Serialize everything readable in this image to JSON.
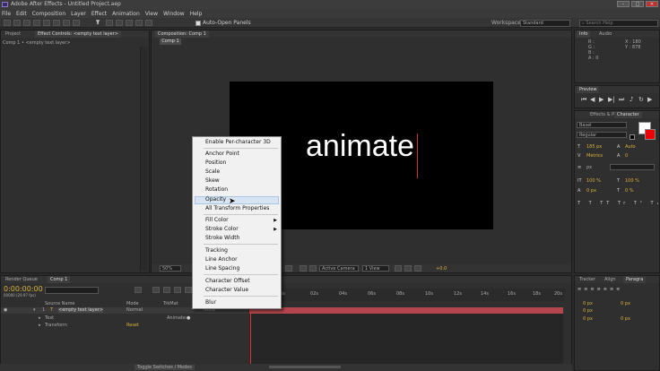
{
  "window": {
    "title": "Adobe After Effects - Untitled Project.aep"
  },
  "menubar": [
    "File",
    "Edit",
    "Composition",
    "Layer",
    "Effect",
    "Animation",
    "View",
    "Window",
    "Help"
  ],
  "toolbar": {
    "auto_open_label": "Auto-Open Panels",
    "workspace_label": "Workspace:",
    "workspace_value": "Standard",
    "search_placeholder": "Search Help"
  },
  "project_panel": {
    "tab_project": "Project",
    "tab_effect_controls": "Effect Controls: <empty text layer>",
    "subtitle": "Comp 1 • <empty text layer>"
  },
  "composition_panel": {
    "tab": "Composition: Comp 1",
    "subtab": "Comp 1",
    "canvas_text": "animate",
    "zoom": "50%",
    "camera": "Active Camera",
    "view": "1 View",
    "exposure": "+0.0"
  },
  "info_panel": {
    "tab_info": "Info",
    "tab_audio": "Audio",
    "r": "R :",
    "g": "G :",
    "b": "B :",
    "a": "A : 0",
    "x": "X : 180",
    "y": "Y : 878"
  },
  "preview_panel": {
    "tab": "Preview"
  },
  "character_panel": {
    "tab_effects": "Effects & Presets",
    "tab_character": "Character",
    "font": "Basel",
    "style": "Regular",
    "size": "185 px",
    "leading": "Auto",
    "kerning": "Metrics",
    "tracking": "0",
    "stroke_width": "px",
    "vscale": "100 %",
    "hscale": "100 %",
    "baseline": "0 px",
    "tsume": "0 %"
  },
  "tracker_panel": {
    "tab_tracker": "Tracker",
    "tab_align": "Align",
    "tab_paragraph": "Paragra",
    "v1": "0 px",
    "v2": "0 px",
    "v3": "0 px",
    "v4": "0 px",
    "v5": "0 px"
  },
  "timeline": {
    "tab_render": "Render Queue",
    "tab_comp": "Comp 1",
    "timecode": "0:00:00:00",
    "fps": "00000 (29.97 fps)",
    "col_source": "Source Name",
    "col_mode": "Mode",
    "col_trkmat": "TrkMat",
    "layer_num": "1",
    "layer_name": "<empty text layer>",
    "layer_mode": "Normal",
    "layer_trkmat": "None",
    "text_row": "Text",
    "animate_label": "Animate:",
    "transform_row": "Transform",
    "reset_label": "Reset",
    "ruler": [
      "0s",
      "02s",
      "04s",
      "06s",
      "08s",
      "10s",
      "12s",
      "14s",
      "16s",
      "18s",
      "20s"
    ],
    "toggle_label": "Toggle Switches / Modes"
  },
  "context_menu": {
    "items": [
      "Enable Per-character 3D",
      "Anchor Point",
      "Position",
      "Scale",
      "Skew",
      "Rotation",
      "Opacity",
      "All Transform Properties",
      "Fill Color",
      "Stroke Color",
      "Stroke Width",
      "Tracking",
      "Line Anchor",
      "Line Spacing",
      "Character Offset",
      "Character Value",
      "Blur"
    ],
    "highlighted": "Opacity"
  }
}
